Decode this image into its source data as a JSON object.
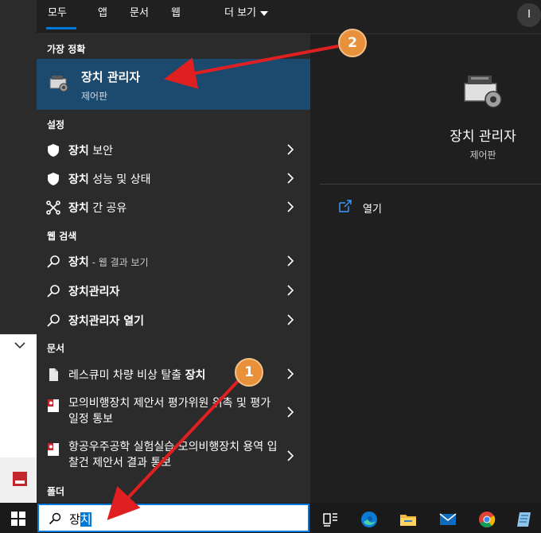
{
  "tabs": [
    {
      "label": "모두"
    },
    {
      "label": "앱"
    },
    {
      "label": "문서"
    },
    {
      "label": "웹"
    },
    {
      "label": "더 보기"
    }
  ],
  "user_initial": "I",
  "best_match": {
    "section": "가장 정확",
    "title": "장치 관리자",
    "subtitle": "제어판"
  },
  "settings": {
    "section": "설정",
    "items": [
      {
        "bold": "장치",
        "rest": " 보안",
        "icon": "shield-icon"
      },
      {
        "bold": "장치",
        "rest": " 성능 및 상태",
        "icon": "shield-icon"
      },
      {
        "bold": "장치",
        "rest": " 간 공유",
        "icon": "share-icon"
      }
    ]
  },
  "web": {
    "section": "웹 검색",
    "items": [
      {
        "bold": "장치",
        "rest": " - 웹 결과 보기"
      },
      {
        "bold": "장치관리자",
        "rest": ""
      },
      {
        "bold": "장치관리자 열기",
        "rest": ""
      }
    ]
  },
  "docs": {
    "section": "문서",
    "items": [
      {
        "pre": "레스큐미 차량 비상 탈출 ",
        "bold": "장치"
      },
      {
        "pre": "모의비행장치 제안서 평가위원 위촉 및 평가 일정 통보",
        "bold": ""
      },
      {
        "pre": "항공우주공학 실험실습 모의비행장치 용역 입찰건 제안서 결과 통보",
        "bold": ""
      }
    ]
  },
  "folders": {
    "section": "폴더"
  },
  "preview": {
    "title": "장치 관리자",
    "subtitle": "제어판",
    "open_label": "열기"
  },
  "search": {
    "typed": "장",
    "selected": "치"
  },
  "annotations": {
    "badge1": "1",
    "badge2": "2",
    "arrow_color": "#e02020"
  },
  "colors": {
    "accent": "#0078d7",
    "highlight": "#1c4a6e",
    "badge": "#e8903a"
  },
  "taskbar_icons": [
    "task-view-icon",
    "edge-icon",
    "file-explorer-icon",
    "mail-icon",
    "chrome-icon",
    "notepad-icon"
  ]
}
